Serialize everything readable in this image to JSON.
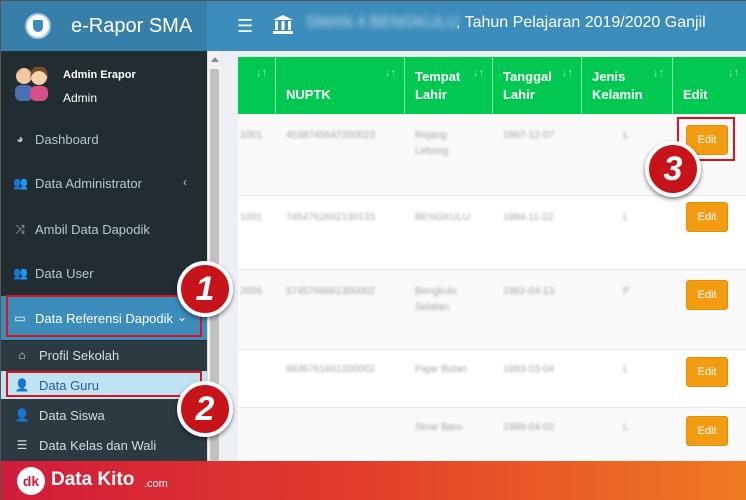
{
  "header": {
    "brand_title": "e-Rapor SMA",
    "school_name": "SMAN 4 BENGKULU",
    "year_text": ", Tahun Pelajaran 2019/2020 Ganjil"
  },
  "user": {
    "role_label": "Admin Erapor",
    "name": "Admin"
  },
  "sidebar": {
    "items": [
      {
        "label": "Dashboard",
        "icon": "dashboard-icon",
        "glyph": "◕"
      },
      {
        "label": "Data Administrator",
        "icon": "users-icon",
        "glyph": "👥",
        "caret": "‹"
      },
      {
        "label": "Ambil Data Dapodik",
        "icon": "shuffle-icon",
        "glyph": "⤨"
      },
      {
        "label": "Data User",
        "icon": "users-icon",
        "glyph": "👥"
      },
      {
        "label": "Data Referensi Dapodik",
        "icon": "desktop-icon",
        "glyph": "▭",
        "caret": "⌄"
      }
    ],
    "submenu": [
      {
        "label": "Profil Sekolah",
        "icon": "home-icon",
        "glyph": "⌂"
      },
      {
        "label": "Data Guru",
        "icon": "user-icon",
        "glyph": "👤"
      },
      {
        "label": "Data Siswa",
        "icon": "user-icon",
        "glyph": "👤"
      },
      {
        "label": "Data Kelas dan Wali",
        "icon": "list-icon",
        "glyph": "☰"
      }
    ]
  },
  "steps": [
    "1",
    "2",
    "3"
  ],
  "table": {
    "headers": [
      {
        "label": "",
        "sort": "↓↑"
      },
      {
        "label": "NUPTK",
        "sort": "↓↑"
      },
      {
        "label": "Tempat Lahir",
        "sort": "↓↑"
      },
      {
        "label": "Tanggal Lahir",
        "sort": "↓↑"
      },
      {
        "label": "Jenis Kelamin",
        "sort": "↓↑"
      },
      {
        "label": "Edit",
        "sort": "↓↑"
      }
    ],
    "rows": [
      {
        "c0": "1001",
        "nuptk": "4538745647200023",
        "tempat": "Rejang Lebong",
        "tanggal": "1987-12-07",
        "jk": "L",
        "edit": "Edit"
      },
      {
        "c0": "1001",
        "nuptk": "7454762662130133",
        "tempat": "BENGKULU",
        "tanggal": "1984-11-22",
        "jk": "L",
        "edit": "Edit"
      },
      {
        "c0": "2006",
        "nuptk": "5745766661300002",
        "tempat": "Bengkulu Selatan",
        "tanggal": "1982-04-13",
        "jk": "P",
        "edit": "Edit"
      },
      {
        "c0": "",
        "nuptk": "6836761661200002",
        "tempat": "Pajar Bulan",
        "tanggal": "1983-03-04",
        "jk": "L",
        "edit": "Edit"
      },
      {
        "c0": "",
        "nuptk": "",
        "tempat": "Sinar Baru",
        "tanggal": "1989-04-02",
        "jk": "L",
        "edit": "Edit"
      }
    ]
  },
  "footer": {
    "logo_text": "dk",
    "brand": "Data Kito",
    "suffix": ".com"
  },
  "colors": {
    "header": "#3c8dbc",
    "sidebar": "#222d32",
    "table_header": "#00c851",
    "edit_button": "#f39c12",
    "highlight": "#e1111a"
  }
}
